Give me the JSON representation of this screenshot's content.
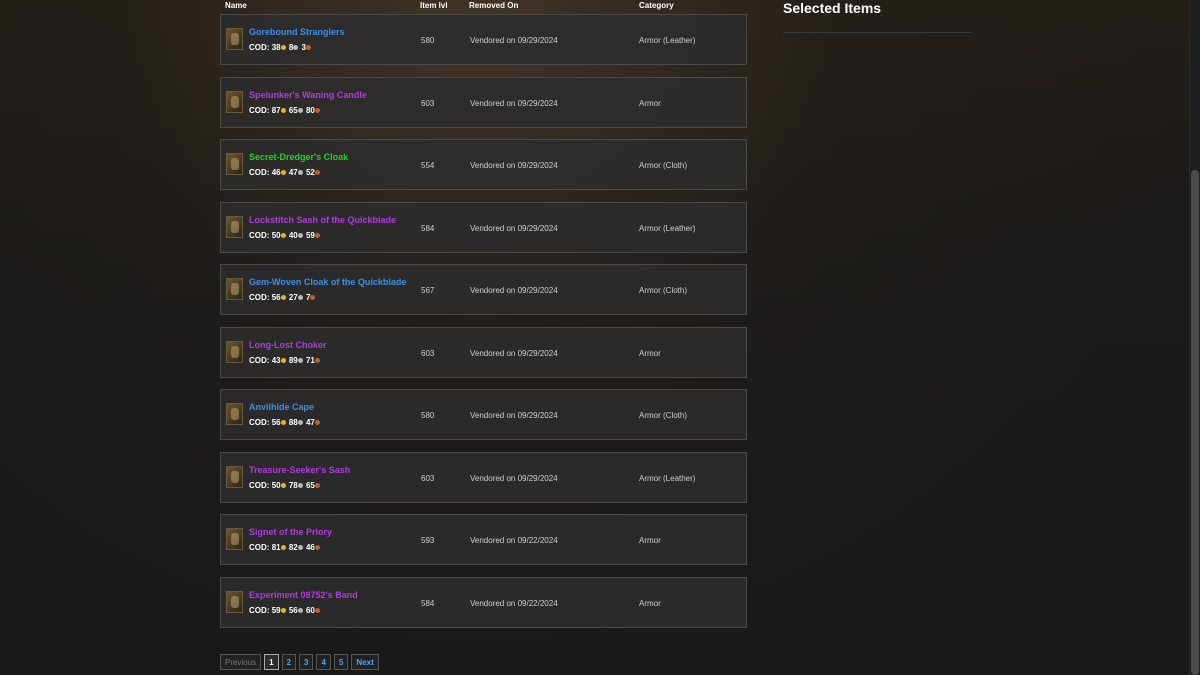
{
  "table": {
    "headers": {
      "name": "Name",
      "item_lvl": "Item lvl",
      "removed_on": "Removed On",
      "category": "Category"
    },
    "cod_label": "COD:",
    "rows": [
      {
        "name": "Gorebound Stranglers",
        "name_color": "#3d8fe6",
        "icon": "gloves-icon",
        "gold": "38",
        "silver": "8",
        "copper": "3",
        "ilvl": "580",
        "removed": "Vendored on 09/29/2024",
        "category": "Armor (Leather)"
      },
      {
        "name": "Spelunker's Waning Candle",
        "name_color": "#b03be0",
        "icon": "candle-icon",
        "gold": "87",
        "silver": "65",
        "copper": "80",
        "ilvl": "603",
        "removed": "Vendored on 09/29/2024",
        "category": "Armor"
      },
      {
        "name": "Secret-Dredger's Cloak",
        "name_color": "#1fd21f",
        "icon": "cloak-icon",
        "gold": "46",
        "silver": "47",
        "copper": "52",
        "ilvl": "554",
        "removed": "Vendored on 09/29/2024",
        "category": "Armor (Cloth)"
      },
      {
        "name": "Lockstitch Sash of the Quickblade",
        "name_color": "#b03be0",
        "icon": "belt-icon",
        "gold": "50",
        "silver": "40",
        "copper": "59",
        "ilvl": "584",
        "removed": "Vendored on 09/29/2024",
        "category": "Armor (Leather)"
      },
      {
        "name": "Gem-Woven Cloak of the Quickblade",
        "name_color": "#3d8fe6",
        "icon": "cloak-icon",
        "gold": "56",
        "silver": "27",
        "copper": "7",
        "ilvl": "567",
        "removed": "Vendored on 09/29/2024",
        "category": "Armor (Cloth)"
      },
      {
        "name": "Long-Lost Choker",
        "name_color": "#b03be0",
        "icon": "necklace-icon",
        "gold": "43",
        "silver": "89",
        "copper": "71",
        "ilvl": "603",
        "removed": "Vendored on 09/29/2024",
        "category": "Armor"
      },
      {
        "name": "Anvilhide Cape",
        "name_color": "#3d8fe6",
        "icon": "cape-icon",
        "gold": "56",
        "silver": "88",
        "copper": "47",
        "ilvl": "580",
        "removed": "Vendored on 09/29/2024",
        "category": "Armor (Cloth)"
      },
      {
        "name": "Treasure-Seeker's Sash",
        "name_color": "#b03be0",
        "icon": "belt-icon",
        "gold": "50",
        "silver": "78",
        "copper": "65",
        "ilvl": "603",
        "removed": "Vendored on 09/29/2024",
        "category": "Armor (Leather)"
      },
      {
        "name": "Signet of the Priory",
        "name_color": "#b03be0",
        "icon": "ring-icon",
        "gold": "81",
        "silver": "82",
        "copper": "46",
        "ilvl": "593",
        "removed": "Vendored on 09/22/2024",
        "category": "Armor"
      },
      {
        "name": "Experiment 08752's Band",
        "name_color": "#b03be0",
        "icon": "ring-icon",
        "gold": "59",
        "silver": "56",
        "copper": "60",
        "ilvl": "584",
        "removed": "Vendored on 09/22/2024",
        "category": "Armor"
      }
    ]
  },
  "pagination": {
    "previous": "Previous",
    "pages": [
      "1",
      "2",
      "3",
      "4",
      "5"
    ],
    "current": "1",
    "next": "Next"
  },
  "selected": {
    "title": "Selected Items"
  },
  "colors": {
    "rare_blue": "#3d8fe6",
    "epic_purple": "#b03be0",
    "uncommon_green": "#1fd21f",
    "gold_coin": "#e3b423",
    "silver_coin": "#b9b9b9",
    "copper_coin": "#c2602a"
  }
}
